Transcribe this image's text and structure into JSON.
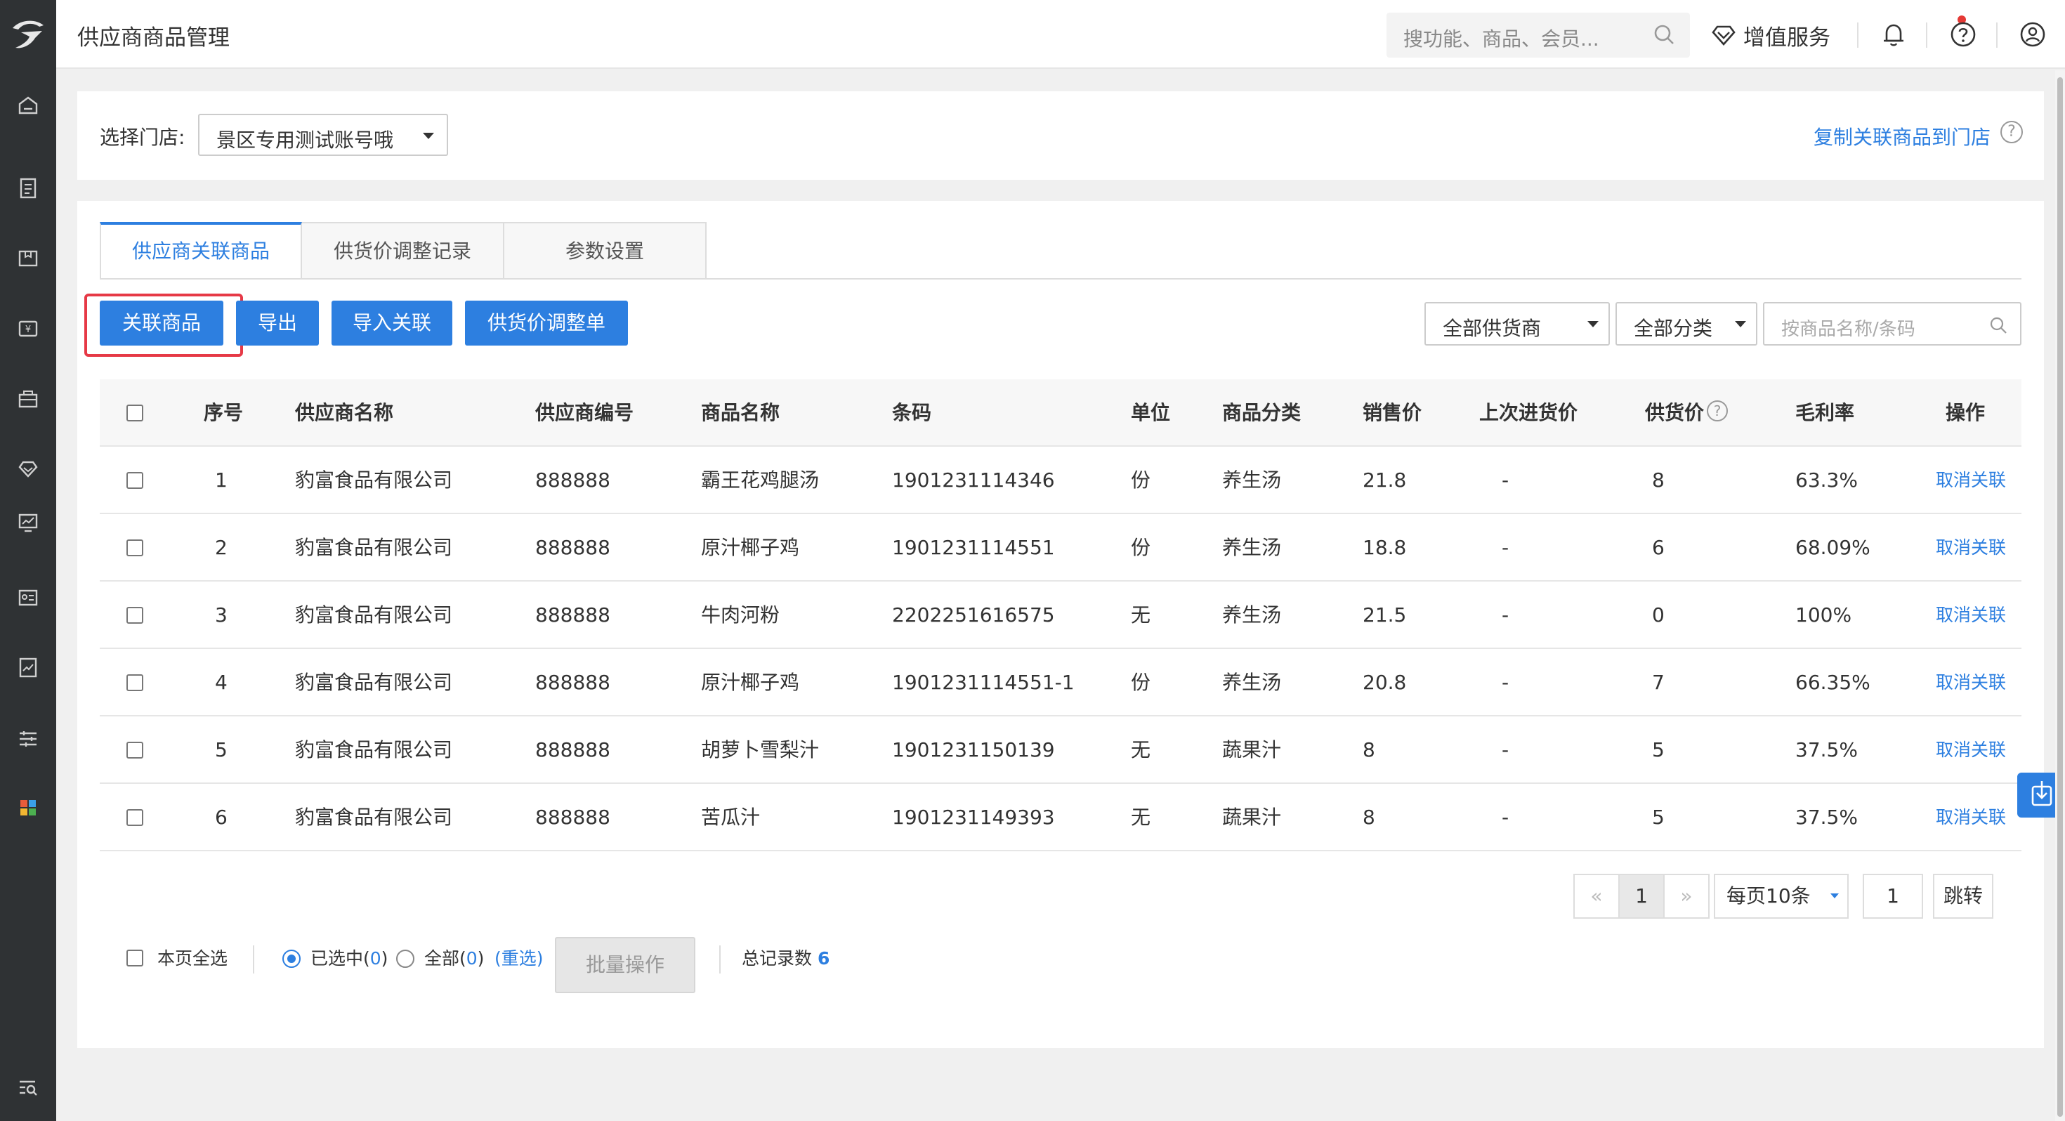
{
  "app": {
    "title": "供应商商品管理"
  },
  "topbar": {
    "search_placeholder": "搜功能、商品、会员...",
    "value_added_label": "增值服务"
  },
  "store": {
    "label": "选择门店:",
    "selected": "景区专用测试账号哦",
    "copy_link": "复制关联商品到门店"
  },
  "tabs": [
    {
      "label": "供应商关联商品",
      "active": true
    },
    {
      "label": "供货价调整记录",
      "active": false
    },
    {
      "label": "参数设置",
      "active": false
    }
  ],
  "toolbar": {
    "link_goods": "关联商品",
    "export": "导出",
    "import_link": "导入关联",
    "price_adjust": "供货价调整单"
  },
  "filters": {
    "supplier": "全部供货商",
    "category": "全部分类",
    "search_placeholder": "按商品名称/条码"
  },
  "table": {
    "headers": {
      "seq": "序号",
      "supplier_name": "供应商名称",
      "supplier_code": "供应商编号",
      "goods_name": "商品名称",
      "barcode": "条码",
      "unit": "单位",
      "category": "商品分类",
      "sale_price": "销售价",
      "last_purchase": "上次进货价",
      "supply_price": "供货价",
      "margin": "毛利率",
      "action": "操作"
    },
    "rows": [
      {
        "seq": "1",
        "supplier_name": "豹富食品有限公司",
        "supplier_code": "888888",
        "goods_name": "霸王花鸡腿汤",
        "barcode": "1901231114346",
        "unit": "份",
        "category": "养生汤",
        "sale_price": "21.8",
        "last_purchase": "-",
        "supply_price": "8",
        "margin": "63.3%",
        "action": "取消关联"
      },
      {
        "seq": "2",
        "supplier_name": "豹富食品有限公司",
        "supplier_code": "888888",
        "goods_name": "原汁椰子鸡",
        "barcode": "1901231114551",
        "unit": "份",
        "category": "养生汤",
        "sale_price": "18.8",
        "last_purchase": "-",
        "supply_price": "6",
        "margin": "68.09%",
        "action": "取消关联"
      },
      {
        "seq": "3",
        "supplier_name": "豹富食品有限公司",
        "supplier_code": "888888",
        "goods_name": "牛肉河粉",
        "barcode": "2202251616575",
        "unit": "无",
        "category": "养生汤",
        "sale_price": "21.5",
        "last_purchase": "-",
        "supply_price": "0",
        "margin": "100%",
        "action": "取消关联"
      },
      {
        "seq": "4",
        "supplier_name": "豹富食品有限公司",
        "supplier_code": "888888",
        "goods_name": "原汁椰子鸡",
        "barcode": "1901231114551-1",
        "unit": "份",
        "category": "养生汤",
        "sale_price": "20.8",
        "last_purchase": "-",
        "supply_price": "7",
        "margin": "66.35%",
        "action": "取消关联"
      },
      {
        "seq": "5",
        "supplier_name": "豹富食品有限公司",
        "supplier_code": "888888",
        "goods_name": "胡萝卜雪梨汁",
        "barcode": "1901231150139",
        "unit": "无",
        "category": "蔬果汁",
        "sale_price": "8",
        "last_purchase": "-",
        "supply_price": "5",
        "margin": "37.5%",
        "action": "取消关联"
      },
      {
        "seq": "6",
        "supplier_name": "豹富食品有限公司",
        "supplier_code": "888888",
        "goods_name": "苦瓜汁",
        "barcode": "1901231149393",
        "unit": "无",
        "category": "蔬果汁",
        "sale_price": "8",
        "last_purchase": "-",
        "supply_price": "5",
        "margin": "37.5%",
        "action": "取消关联"
      }
    ]
  },
  "pagination": {
    "prev": "«",
    "current": "1",
    "next": "»",
    "page_size": "每页10条",
    "jump_value": "1",
    "jump_label": "跳转"
  },
  "footer": {
    "select_page": "本页全选",
    "selected_label": "已选中(",
    "selected_count": "0",
    "all_label": "全部(",
    "all_count": "0",
    "close_paren": ")",
    "reselect": "(重选)",
    "batch": "批量操作",
    "total_label": "总记录数",
    "total": "6"
  },
  "colors": {
    "accent": "#2d7fe0",
    "sidebar": "#2f3234",
    "highlight": "#e63946"
  }
}
